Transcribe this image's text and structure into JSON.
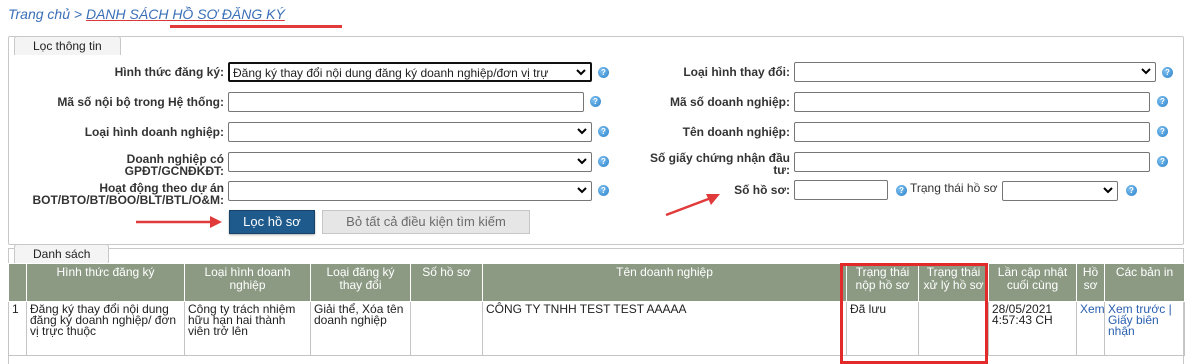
{
  "breadcrumb": {
    "home": "Trang chủ",
    "separator": ">",
    "current": "DANH SÁCH HỒ SƠ ĐĂNG KÝ"
  },
  "filter": {
    "legend": "Lọc thông tin",
    "fields": {
      "registration_form_label": "Hình thức đăng ký:",
      "registration_form_value": "Đăng ký thay đổi nội dung đăng ký doanh nghiệp/đơn vị trự",
      "change_type_label": "Loại hình thay đổi:",
      "change_type_value": "",
      "internal_code_label": "Mã số nội bộ trong Hệ thống:",
      "internal_code_value": "",
      "enterprise_code_label": "Mã số doanh nghiệp:",
      "enterprise_code_value": "",
      "enterprise_type_label": "Loại hình doanh nghiệp:",
      "enterprise_type_value": "",
      "enterprise_name_label": "Tên doanh nghiệp:",
      "enterprise_name_value": "",
      "has_license_label_1": "Doanh nghiệp có",
      "has_license_label_2": "GPĐT/GCNĐKĐT:",
      "has_license_value": "",
      "investment_cert_label_1": "Số giấy chứng nhận đầu",
      "investment_cert_label_2": "tư:",
      "investment_cert_value": "",
      "project_label_1": "Hoạt động theo dự án",
      "project_label_2": "BOT/BTO/BT/BOO/BLT/BTL/O&M:",
      "project_value": "",
      "dossier_no_label": "Số hồ sơ:",
      "dossier_no_value": "",
      "dossier_status_label": "Trạng thái hồ sơ",
      "dossier_status_value": ""
    },
    "filter_button": "Lọc hồ sơ",
    "clear_button": "Bỏ tất cả điều kiện tìm kiếm"
  },
  "list": {
    "legend": "Danh sách",
    "columns": [
      "",
      "Hình thức đăng ký",
      "Loại hình doanh nghiệp",
      "Loại đăng ký thay đổi",
      "Số hồ sơ",
      "Tên doanh nghiệp",
      "Trạng thái nộp hồ sơ",
      "Trạng thái xử lý hồ sơ",
      "Lần cập nhật cuối cùng",
      "Hồ sơ",
      "Các bản in"
    ],
    "rows": [
      {
        "index": "1",
        "registration_form": "Đăng ký thay đổi nội dung đăng ký doanh nghiệp/ đơn vị trực thuộc",
        "enterprise_type": "Công ty trách nhiệm hữu hạn hai thành viên trở lên",
        "change_type": "Giải thể, Xóa tên doanh nghiệp",
        "dossier_no": "",
        "enterprise_name": "CÔNG TY TNHH TEST TEST AAAAA",
        "submit_status": "Đã lưu",
        "process_status": "",
        "last_update": "28/05/2021 4:57:43 CH",
        "view": "Xem",
        "prints": "Xem trước | Giấy biên nhận"
      }
    ]
  },
  "colors": {
    "header_bg": "#8c9a84",
    "primary_button": "#1f5a8c",
    "highlight": "#e22a2a",
    "link": "#3a6fb8"
  }
}
